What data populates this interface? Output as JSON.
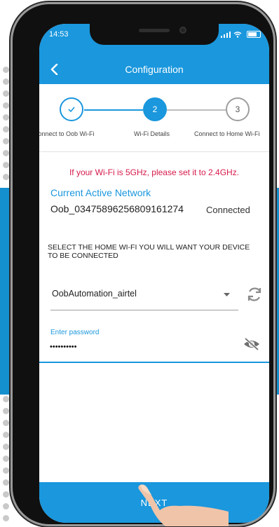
{
  "status_bar": {
    "time": "14:53"
  },
  "header": {
    "title": "Configuration",
    "back_icon": "chevron-left-icon"
  },
  "stepper": {
    "steps": [
      {
        "number": "1",
        "label": "Connect to Oob Wi-Fi",
        "state": "done",
        "icon": "check-icon"
      },
      {
        "number": "2",
        "label": "Wi-Fi Details",
        "state": "active"
      },
      {
        "number": "3",
        "label": "Connect to Home Wi-Fi",
        "state": "todo"
      }
    ]
  },
  "warning": "If your Wi-Fi is 5GHz, please set it to 2.4GHz.",
  "current_network": {
    "title": "Current Active Network",
    "ssid": "Oob_03475896256809161274",
    "status": "Connected"
  },
  "instruction": "SELECT THE HOME WI-FI YOU WILL WANT YOUR DEVICE TO BE CONNECTED",
  "wifi_select": {
    "selected": "OobAutomation_airtel",
    "refresh_icon": "refresh-icon"
  },
  "password": {
    "label": "Enter password",
    "value": "••••••••••",
    "visibility_icon": "eye-off-icon"
  },
  "next_button": {
    "label": "NEXT"
  },
  "colors": {
    "primary": "#1a97dd",
    "warning": "#d6194a",
    "band": "#1590cf"
  }
}
